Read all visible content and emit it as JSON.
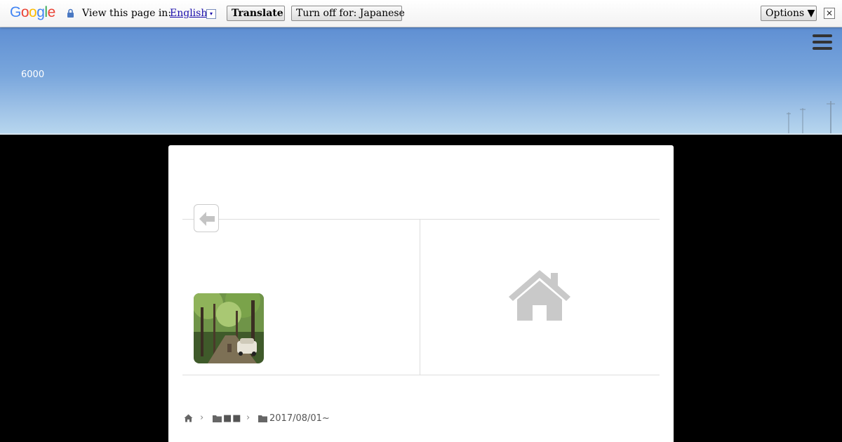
{
  "translate_bar": {
    "logo_letters": [
      "G",
      "o",
      "o",
      "g",
      "l",
      "e"
    ],
    "view_label": "View this page in:",
    "language": "English",
    "dropdown_glyph": "▾",
    "translate_button": "Translate",
    "turn_off_button": "Turn off for: Japanese",
    "options_button": "Options ▼",
    "close_glyph": "✕"
  },
  "header": {
    "site_title": "6000",
    "menu_icon": "hamburger-menu-icon"
  },
  "post_nav": {
    "prev_icon": "arrow-left-icon",
    "home_icon": "home-icon"
  },
  "breadcrumb": {
    "home_icon": "home-icon",
    "separator": "›",
    "category_1": "■■",
    "category_2": "2017/08/01~"
  },
  "colors": {
    "page_background": "#000000",
    "header_sky_top": "#5f8fd3",
    "header_sky_bottom": "#b7d6ee",
    "link": "#1a0dab"
  }
}
